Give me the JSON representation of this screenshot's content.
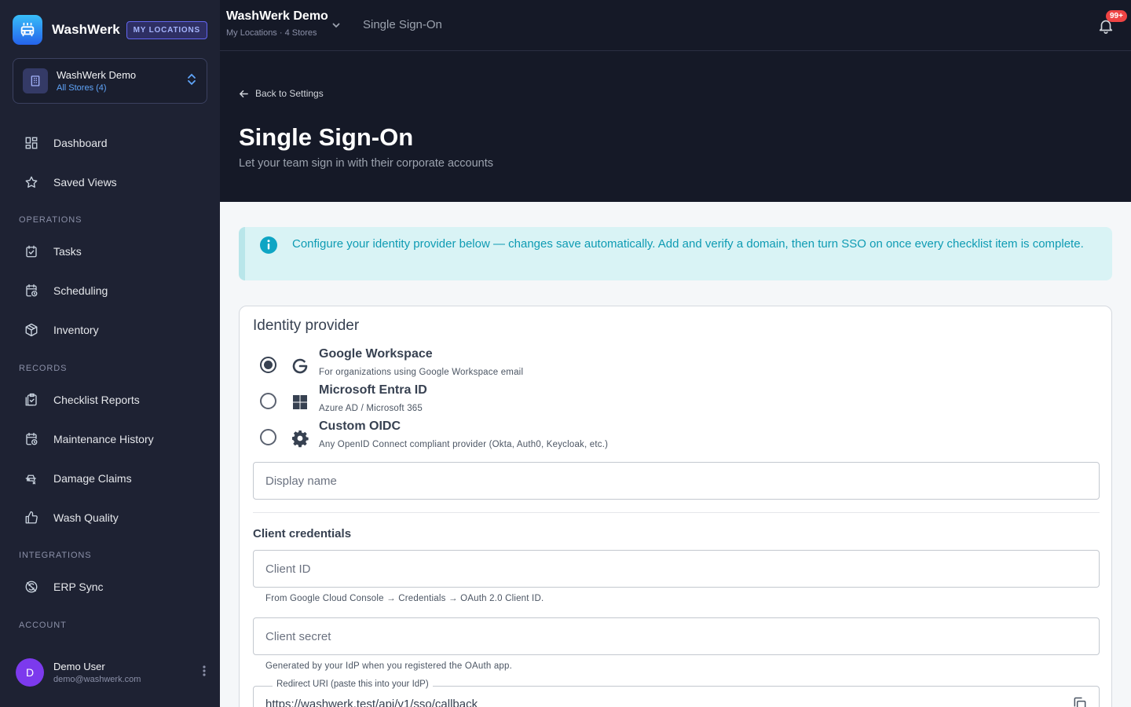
{
  "brand": {
    "name": "WashWerk",
    "badge": "MY LOCATIONS"
  },
  "org": {
    "name": "WashWerk Demo",
    "sub": "All Stores (4)"
  },
  "nav": {
    "dashboard": "Dashboard",
    "saved_views": "Saved Views",
    "section_operations": "OPERATIONS",
    "tasks": "Tasks",
    "scheduling": "Scheduling",
    "inventory": "Inventory",
    "section_records": "RECORDS",
    "checklist_reports": "Checklist Reports",
    "maintenance_history": "Maintenance History",
    "damage_claims": "Damage Claims",
    "wash_quality": "Wash Quality",
    "section_integrations": "INTEGRATIONS",
    "erp_sync": "ERP Sync",
    "section_account": "ACCOUNT"
  },
  "user": {
    "initial": "D",
    "name": "Demo User",
    "email": "demo@washwerk.com"
  },
  "topbar": {
    "title": "WashWerk Demo",
    "sub": "My Locations · 4 Stores",
    "crumb": "Single Sign-On",
    "notifications": "99+"
  },
  "header": {
    "back": "Back to Settings",
    "title": "Single Sign-On",
    "subtitle": "Let your team sign in with their corporate accounts"
  },
  "alert": {
    "text": "Configure your identity provider below — changes save automatically. Add and verify a domain, then turn SSO on once every checklist item is complete."
  },
  "idp": {
    "title": "Identity provider",
    "selected": "google",
    "options": [
      {
        "id": "google",
        "title": "Google Workspace",
        "desc": "For organizations using Google Workspace email"
      },
      {
        "id": "microsoft",
        "title": "Microsoft Entra ID",
        "desc": "Azure AD / Microsoft 365"
      },
      {
        "id": "oidc",
        "title": "Custom OIDC",
        "desc": "Any OpenID Connect compliant provider (Okta, Auth0, Keycloak, etc.)"
      }
    ],
    "display_name_placeholder": "Display name",
    "display_name_value": "",
    "credentials_title": "Client credentials",
    "client_id_placeholder": "Client ID",
    "client_id_helper": "From Google Cloud Console → Credentials → OAuth 2.0 Client ID.",
    "client_secret_placeholder": "Client secret",
    "client_secret_helper": "Generated by your IdP when you registered the OAuth app.",
    "redirect_label": "Redirect URI (paste this into your IdP)",
    "redirect_value": "https://washwerk.test/api/v1/sso/callback"
  },
  "colors": {
    "sidebar": "#1e2233",
    "header": "#151927",
    "accent": "#0e9bb3",
    "badge": "#ef4444",
    "avatar": "#7c3aed"
  }
}
